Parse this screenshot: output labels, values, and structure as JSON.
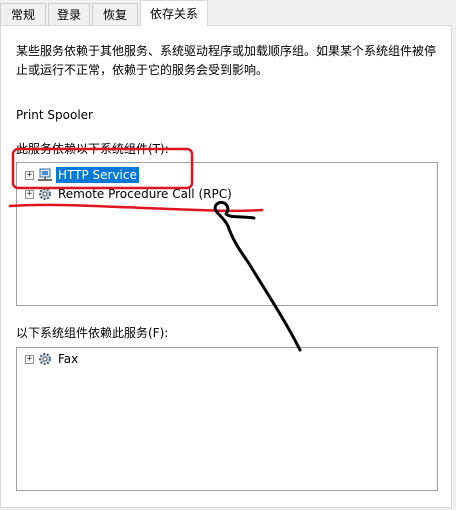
{
  "tabs": [
    {
      "label": "常规"
    },
    {
      "label": "登录"
    },
    {
      "label": "恢复"
    },
    {
      "label": "依存关系"
    }
  ],
  "description": "某些服务依赖于其他服务、系统驱动程序或加载顺序组。如果某个系统组件被停止或运行不正常，依赖于它的服务会受到影响。",
  "service_name": "Print Spooler",
  "depends_on": {
    "label": "此服务依赖以下系统组件(T):",
    "items": [
      {
        "label": "HTTP Service",
        "icon": "network-service-icon",
        "expander": "+"
      },
      {
        "label": "Remote Procedure Call (RPC)",
        "icon": "gear-service-icon",
        "expander": "+"
      }
    ]
  },
  "dependents": {
    "label": "以下系统组件依赖此服务(F):",
    "items": [
      {
        "label": "Fax",
        "icon": "gear-service-icon",
        "expander": "+"
      }
    ]
  },
  "colors": {
    "selection": "#0078d7",
    "annotation_red": "#e0141e",
    "annotation_black": "#000000"
  }
}
